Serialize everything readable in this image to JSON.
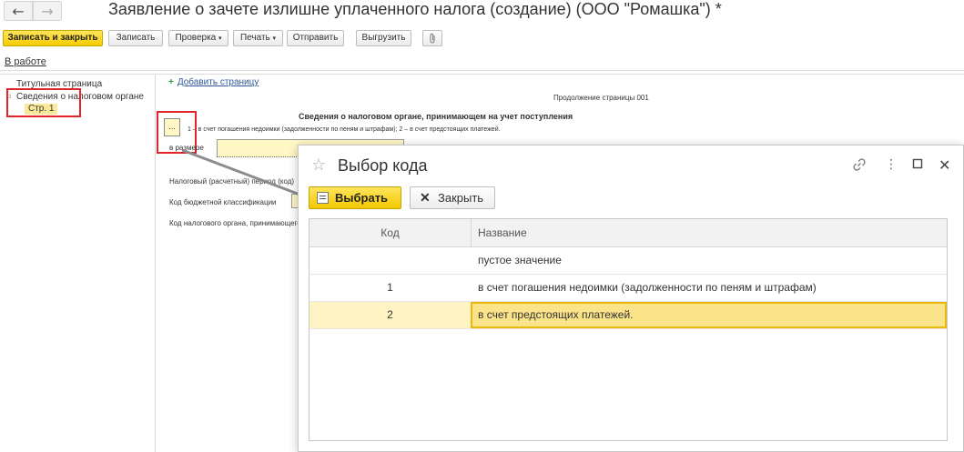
{
  "window": {
    "title": "Заявление о зачете излишне уплаченного налога (создание) (ООО \"Ромашка\") *",
    "nav_back": "←",
    "nav_forward": "→"
  },
  "toolbar": {
    "save_close": "Записать и закрыть",
    "save": "Записать",
    "check": "Проверка",
    "print": "Печать",
    "send": "Отправить",
    "export": "Выгрузить",
    "dropdown_arrow": "▾",
    "clip_icon": "paperclip-icon"
  },
  "status": {
    "label": "В работе"
  },
  "tree": {
    "items": [
      {
        "label": "Титульная страница"
      },
      {
        "label": "Сведения о налоговом органе"
      },
      {
        "label": "Стр. 1"
      }
    ]
  },
  "document": {
    "add_page": "Добавить страницу",
    "add_page_plus": "+",
    "continuation": "Продолжение страницы 001",
    "section_title": "Сведения о налоговом органе, принимающем на учет поступления",
    "code_hint": "1 – в счет погашения недоимки (задолженности по пеням и штрафам); 2 – в счет предстоящих платежей.",
    "code_cell_value": "...",
    "amount_label": "в размере",
    "period_label": "Налоговый (расчетный) период (код)",
    "kbk_label": "Код бюджетной классификации",
    "tax_office_label": "Код налогового органа, принимающего"
  },
  "dialog": {
    "title": "Выбор кода",
    "select_button": "Выбрать",
    "close_button": "Закрыть",
    "columns": {
      "code": "Код",
      "name": "Название"
    },
    "rows": [
      {
        "code": "",
        "name": "пустое значение"
      },
      {
        "code": "1",
        "name": "в счет погашения недоимки (задолженности по пеням и штрафам)"
      },
      {
        "code": "2",
        "name": "в счет предстоящих платежей."
      }
    ],
    "selected_row": 2,
    "icons": {
      "star": "star-icon",
      "link": "link-icon",
      "more": "more-icon",
      "maximize": "maximize-icon",
      "close": "close-icon"
    }
  },
  "colors": {
    "accent_yellow": "#f5cc00",
    "highlight_red": "#e0262b",
    "selection": "#fbe38a"
  }
}
